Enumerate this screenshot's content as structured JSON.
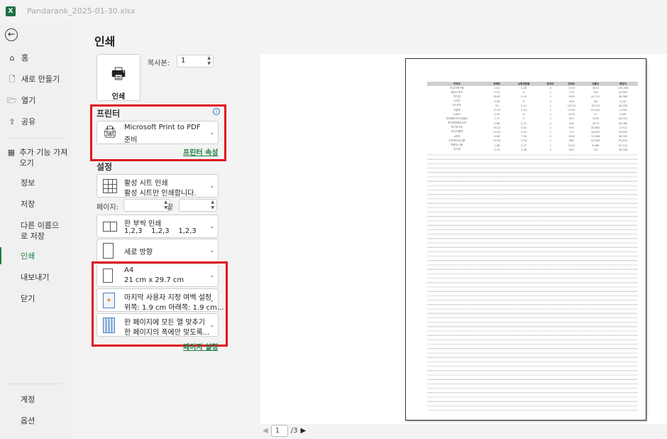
{
  "window": {
    "file_name": "Pandarank_2025-01-30.xlsx",
    "app_icon": "excel-icon"
  },
  "sidebar": {
    "back_icon": "back-arrow-icon",
    "items": [
      {
        "label": "홈",
        "icon": "home-icon"
      },
      {
        "label": "새로 만들기",
        "icon": "new-doc-icon"
      },
      {
        "label": "열기",
        "icon": "folder-open-icon"
      },
      {
        "label": "공유",
        "icon": "share-icon"
      },
      {
        "label": "추가 기능 가져오기",
        "icon": "addins-icon"
      },
      {
        "label": "정보"
      },
      {
        "label": "저장"
      },
      {
        "label": "다른 이름으로 저장"
      },
      {
        "label": "인쇄",
        "active": true
      },
      {
        "label": "내보내기"
      },
      {
        "label": "닫기"
      },
      {
        "label": "계정"
      },
      {
        "label": "옵션"
      }
    ]
  },
  "print": {
    "title": "인쇄",
    "print_button": "인쇄",
    "copies_label": "복사본:",
    "copies_value": "1",
    "printer_section": "프린터",
    "printer_name": "Microsoft Print to PDF",
    "printer_status": "준비",
    "printer_properties": "프린터 속성",
    "settings_section": "설정",
    "what": {
      "l1": "활성 시트 인쇄",
      "l2": "활성 시트만 인쇄합니다."
    },
    "pages_label": "페이지:",
    "to_label": "끝",
    "pages_from": "",
    "pages_to": "",
    "collate": {
      "l1": "한 부씩 인쇄",
      "l2": "1,2,3    1,2,3    1,2,3"
    },
    "orientation": "세로 방향",
    "paper": {
      "l1": "A4",
      "l2": "21 cm x 29.7 cm"
    },
    "margins": {
      "l1": "마지막 사용자 지정 여백 설정",
      "l2": "위쪽: 1.9 cm 아래쪽: 1.9 cm..."
    },
    "scaling": {
      "l1": "한 페이지에 모든 열 맞추기",
      "l2": "한 페이지의 폭에만 맞도록..."
    },
    "page_setup": "페이지 설정",
    "accent": "#1e7e45",
    "highlight": "#e0141e"
  },
  "preview": {
    "current_page": "1",
    "total_pages": "/3",
    "headers": [
      "키워드",
      "경쟁도",
      "쇼핑전환율",
      "광고비",
      "검색수",
      "상품수",
      "평균가"
    ],
    "rows": [
      [
        "초심자축구화",
        "2.61",
        "2.28",
        "-1",
        "1210",
        "3023",
        "105,008"
      ],
      [
        "준비스포츠",
        "0.25",
        "0",
        "-1",
        "770",
        "194",
        "10,650"
      ],
      [
        "풋가방",
        "34.67",
        "0.41",
        "-1",
        "1450",
        "50,721",
        "36,986"
      ],
      [
        "U라인",
        "3.08",
        "0",
        "-1",
        "420",
        "36",
        "3,267"
      ],
      [
        "a스포츠",
        "55",
        "0.21",
        "-1",
        "10113",
        "55115",
        "44,250"
      ],
      [
        "각렴포",
        "15.22",
        "2.54",
        "-1",
        "2140",
        "41,541",
        "1,334"
      ],
      [
        "a-887",
        "0.05",
        "0",
        "-1",
        "1070",
        "57",
        "1,967"
      ],
      [
        "라면매드리드어웨이",
        "1.72",
        "0",
        "-1",
        "810",
        "1356",
        "84,020"
      ],
      [
        "축구양면축트조끼",
        "4.66",
        "0.71",
        "-1",
        "440",
        "1973",
        "62,080"
      ],
      [
        "축구토조끼",
        "59.22",
        "4.62",
        "-1",
        "670",
        "39,682",
        "3,912"
      ],
      [
        "파니어블백",
        "22.67",
        "0.19",
        "-1",
        "710",
        "16,097",
        "33,620"
      ],
      [
        "a머지",
        "8.58",
        "7.54",
        "-1",
        "1430",
        "12,846",
        "38,940"
      ],
      [
        "키즈축구유니폼",
        "50.52",
        "3.54",
        "-1",
        "660",
        "33,345",
        "29,870"
      ],
      [
        "판완유니폼",
        "2.58",
        "2.27",
        "-1",
        "2310",
        "6,066",
        "52,110"
      ],
      [
        "지가방",
        "0.74",
        "1.38",
        "-1",
        "820",
        "132",
        "26,900"
      ]
    ]
  }
}
